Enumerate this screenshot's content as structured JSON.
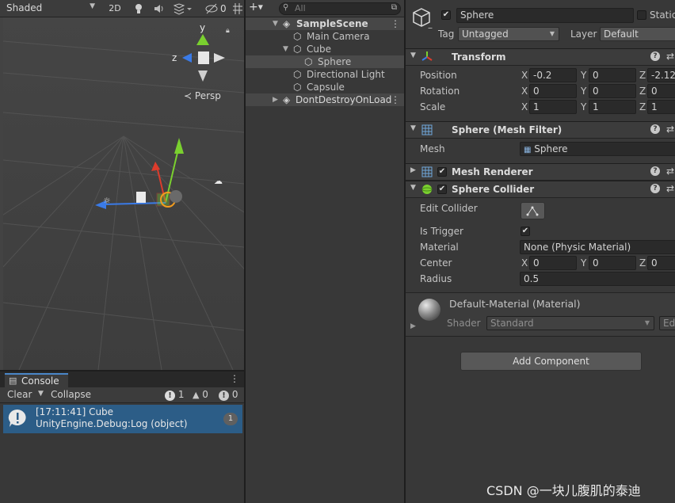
{
  "scene_toolbar": {
    "draw_mode": "Shaded",
    "toggle_2d": "2D",
    "gizmo_count": "0"
  },
  "scene_view": {
    "gizmo_y": "y",
    "gizmo_z": "z",
    "projection_label": "Persp"
  },
  "hierarchy": {
    "search_placeholder": "All",
    "items": [
      {
        "label": "SampleScene"
      },
      {
        "label": "Main Camera"
      },
      {
        "label": "Cube"
      },
      {
        "label": "Sphere"
      },
      {
        "label": "Directional Light"
      },
      {
        "label": "Capsule"
      },
      {
        "label": "DontDestroyOnLoad"
      }
    ]
  },
  "console": {
    "tab_label": "Console",
    "clear_label": "Clear",
    "collapse_label": "Collapse",
    "info_count": "1",
    "warn_count": "0",
    "error_count": "0",
    "entries": [
      {
        "line1": "[17:11:41] Cube",
        "line2": "UnityEngine.Debug:Log (object)",
        "count": "1"
      }
    ]
  },
  "inspector": {
    "object_name": "Sphere",
    "static_label": "Static",
    "tag_label": "Tag",
    "tag_value": "Untagged",
    "layer_label": "Layer",
    "layer_value": "Default",
    "transform": {
      "title": "Transform",
      "position_label": "Position",
      "rotation_label": "Rotation",
      "scale_label": "Scale",
      "axis_x": "X",
      "axis_y": "Y",
      "axis_z": "Z",
      "position": {
        "x": "-0.2",
        "y": "0",
        "z": "-2.12"
      },
      "rotation": {
        "x": "0",
        "y": "0",
        "z": "0"
      },
      "scale": {
        "x": "1",
        "y": "1",
        "z": "1"
      }
    },
    "mesh_filter": {
      "title": "Sphere (Mesh Filter)",
      "mesh_label": "Mesh",
      "mesh_value": "Sphere"
    },
    "mesh_renderer": {
      "title": "Mesh Renderer"
    },
    "sphere_collider": {
      "title": "Sphere Collider",
      "edit_label": "Edit Collider",
      "trigger_label": "Is Trigger",
      "material_label": "Material",
      "material_value": "None (Physic Material)",
      "center_label": "Center",
      "center": {
        "x": "0",
        "y": "0",
        "z": "0"
      },
      "radius_label": "Radius",
      "radius_value": "0.5"
    },
    "material": {
      "name": "Default-Material (Material)",
      "shader_label": "Shader",
      "shader_value": "Standard",
      "edit_label": "Ed"
    },
    "add_component_label": "Add Component"
  },
  "watermark": "CSDN @一块儿腹肌的泰迪",
  "colors": {
    "selection": "#2c5d87",
    "panel": "#383838",
    "field": "#2a2a2a",
    "x_axis": "#dc3c2c",
    "y_axis": "#7ad02f",
    "z_axis": "#3a7be8"
  }
}
